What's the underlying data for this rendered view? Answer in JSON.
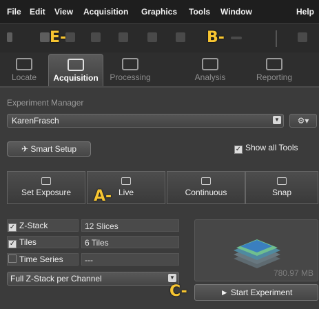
{
  "menu": [
    "File",
    "Edit",
    "View",
    "Acquisition",
    "Graphics",
    "Tools",
    "Window",
    "Help"
  ],
  "callouts": {
    "a": "A-",
    "b": "B-",
    "c": "C-",
    "e": "E-"
  },
  "tabs": [
    {
      "label": "Locate",
      "active": false
    },
    {
      "label": "Acquisition",
      "active": true
    },
    {
      "label": "Processing",
      "active": false
    },
    {
      "label": "Analysis",
      "active": false
    },
    {
      "label": "Reporting",
      "active": false
    }
  ],
  "experiment_manager": {
    "title": "Experiment Manager",
    "value": "KarenFrasch",
    "gear": "⚙▾"
  },
  "smart_setup": "✈ Smart Setup",
  "show_all_tools": "Show all Tools",
  "acq_buttons": [
    "Set Exposure",
    "Live",
    "Continuous",
    "Snap"
  ],
  "settings": [
    {
      "label": "Z-Stack",
      "checked": true,
      "value": "12 Slices"
    },
    {
      "label": "Tiles",
      "checked": true,
      "value": "6 Tiles"
    },
    {
      "label": "Time Series",
      "checked": false,
      "value": "---"
    }
  ],
  "zstack_mode": "Full Z-Stack per Channel",
  "preview_size": "780.97 MB",
  "start_button": "► Start Experiment"
}
